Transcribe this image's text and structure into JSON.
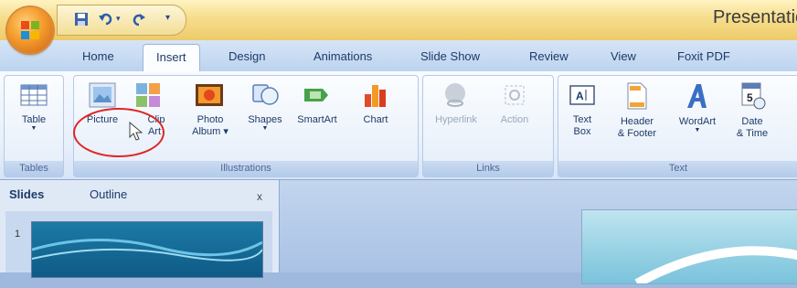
{
  "app_title": "Presentatio",
  "qat": {
    "save_icon": "save-icon",
    "undo_icon": "undo-icon",
    "redo_icon": "redo-icon",
    "customize": "▾"
  },
  "tabs": [
    {
      "label": "Home"
    },
    {
      "label": "Insert",
      "active": true
    },
    {
      "label": "Design"
    },
    {
      "label": "Animations"
    },
    {
      "label": "Slide Show"
    },
    {
      "label": "Review"
    },
    {
      "label": "View"
    },
    {
      "label": "Foxit PDF"
    }
  ],
  "groups": {
    "tables": "Tables",
    "illustrations": "Illustrations",
    "links": "Links",
    "text": "Text"
  },
  "buttons": {
    "table": "Table",
    "picture": "Picture",
    "clip_art_1": "Clip",
    "clip_art_2": "Art",
    "photo_album_1": "Photo",
    "photo_album_2": "Album",
    "shapes": "Shapes",
    "smartart": "SmartArt",
    "chart": "Chart",
    "hyperlink": "Hyperlink",
    "action": "Action",
    "text_box_1": "Text",
    "text_box_2": "Box",
    "header_footer_1": "Header",
    "header_footer_2": "& Footer",
    "wordart": "WordArt",
    "date_time_1": "Date",
    "date_time_2": "& Time"
  },
  "pane": {
    "slides_tab": "Slides",
    "outline_tab": "Outline",
    "close": "x",
    "slide_number": "1"
  },
  "colors": {
    "annotation": "#e02626",
    "ribbon_text": "#1e3a68"
  }
}
